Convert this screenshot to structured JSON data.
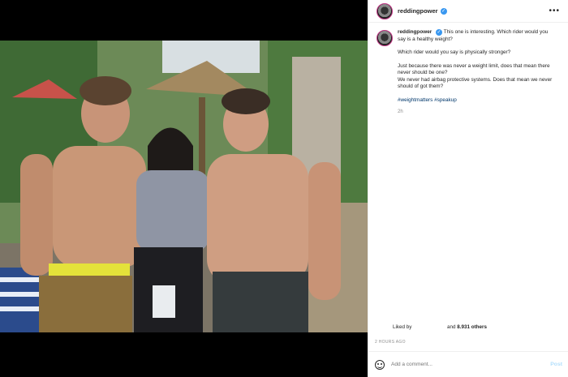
{
  "post": {
    "username": "reddingpower",
    "verified_glyph": "✓",
    "more_glyph": "•••"
  },
  "caption": {
    "username": "reddingpower",
    "line1": "This one is interesting. Which rider would you say is a healthy weight?",
    "line2": "Which rider would you say is physically stronger?",
    "line3": "Just because there was never a weight limit, does that mean there never should be one?",
    "line4": "We never had airbag protective systems. Does that mean we never should of got them?",
    "hashtags": "#weightmatters #speakup",
    "time_ago": "2h"
  },
  "likes": {
    "prefix": "Liked by",
    "suffix": "and",
    "count": "8.931 others"
  },
  "date": "2 HOURS AGO",
  "comment": {
    "placeholder": "Add a comment...",
    "post_label": "Post"
  },
  "colors": {
    "link": "#00376b",
    "verified": "#3897f0",
    "post_disabled": "#b2dffc"
  },
  "icons": [
    "more-options-icon",
    "verified-icon",
    "emoji-icon"
  ]
}
